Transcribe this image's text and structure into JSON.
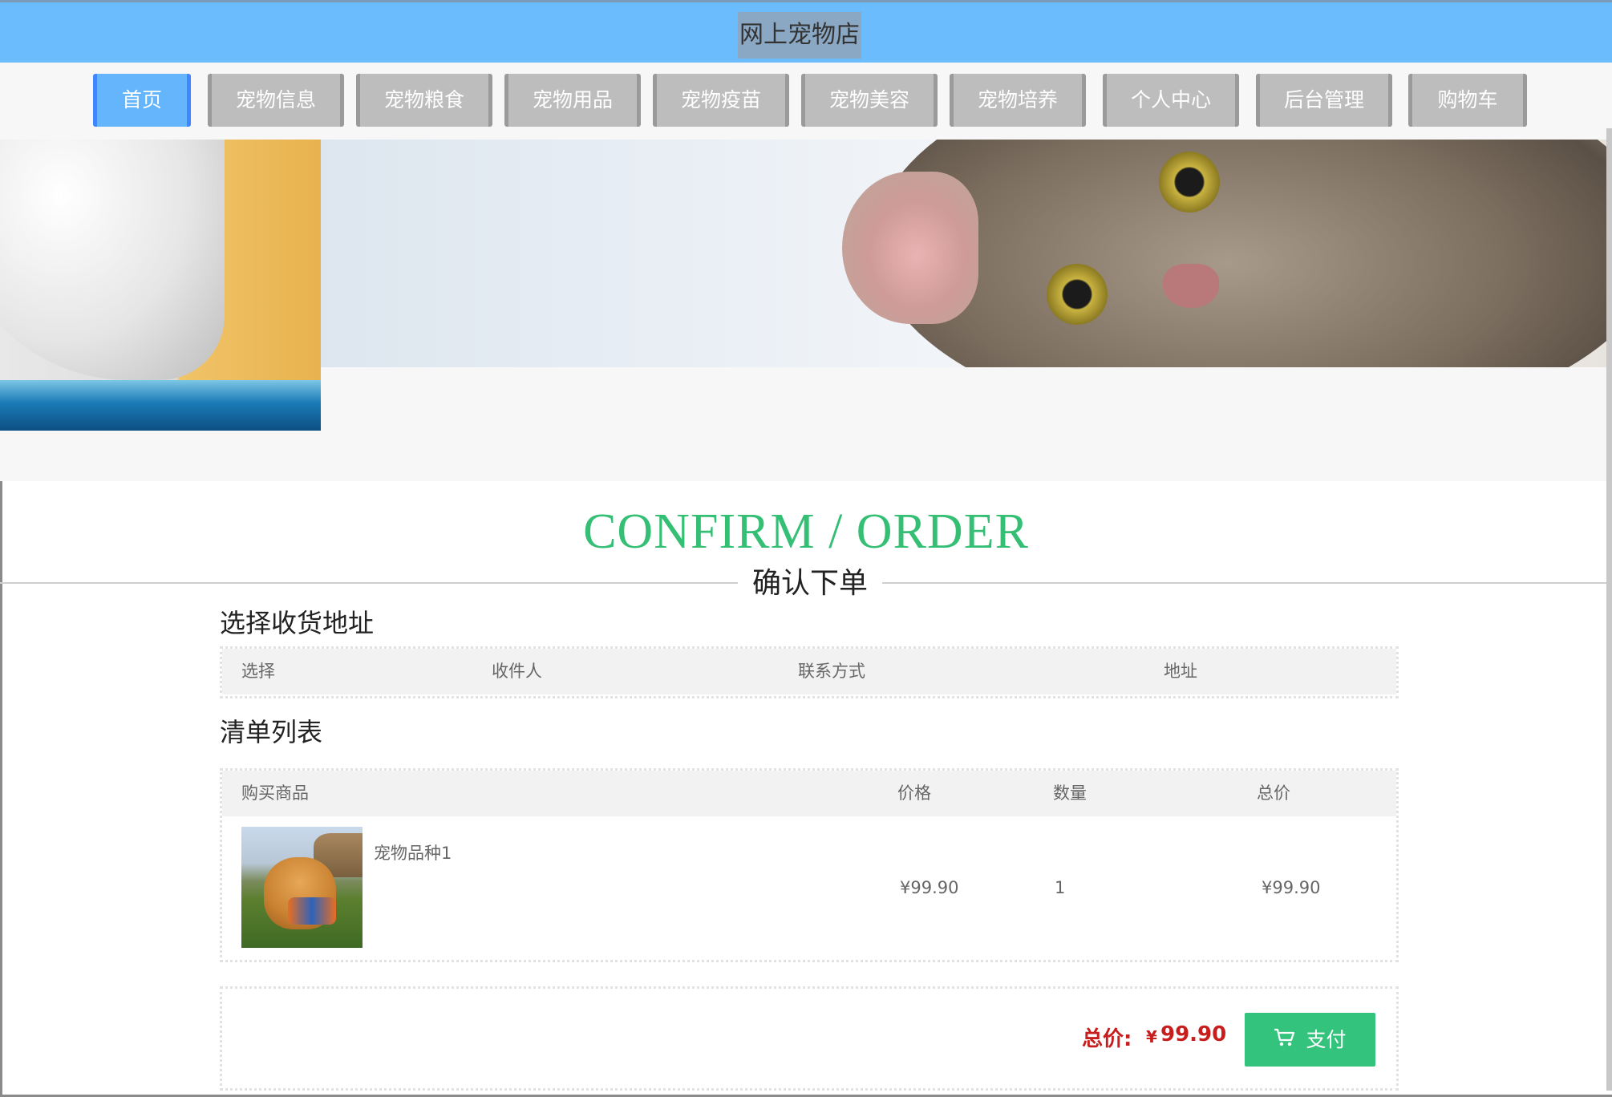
{
  "header": {
    "site_title": "网上宠物店"
  },
  "nav": {
    "items": [
      {
        "label": "首页"
      },
      {
        "label": "宠物信息"
      },
      {
        "label": "宠物粮食"
      },
      {
        "label": "宠物用品"
      },
      {
        "label": "宠物疫苗"
      },
      {
        "label": "宠物美容"
      },
      {
        "label": "宠物培养"
      },
      {
        "label": "个人中心"
      },
      {
        "label": "后台管理"
      },
      {
        "label": "购物车"
      }
    ],
    "active": "首页"
  },
  "page": {
    "heading_en": "CONFIRM / ORDER",
    "heading_zh": "确认下单"
  },
  "address": {
    "title": "选择收货地址",
    "columns": [
      "选择",
      "收件人",
      "联系方式",
      "地址"
    ]
  },
  "order": {
    "title": "清单列表",
    "columns": [
      "购买商品",
      "价格",
      "数量",
      "总价"
    ],
    "items": [
      {
        "name": "宠物品种1",
        "price": "¥99.90",
        "quantity": "1",
        "subtotal": "¥99.90"
      }
    ]
  },
  "summary": {
    "total_label": "总价:",
    "currency": "¥",
    "total_value": "99.90",
    "pay_label": "支付"
  },
  "colors": {
    "topbar": "#6bbcfd",
    "nav_active": "#64b5fb",
    "nav_inactive": "#bdbdbd",
    "heading_green": "#34bf74",
    "pay_button": "#34c37c",
    "total_red": "#c81d1d"
  },
  "icons": {
    "pay": "cart-icon"
  }
}
